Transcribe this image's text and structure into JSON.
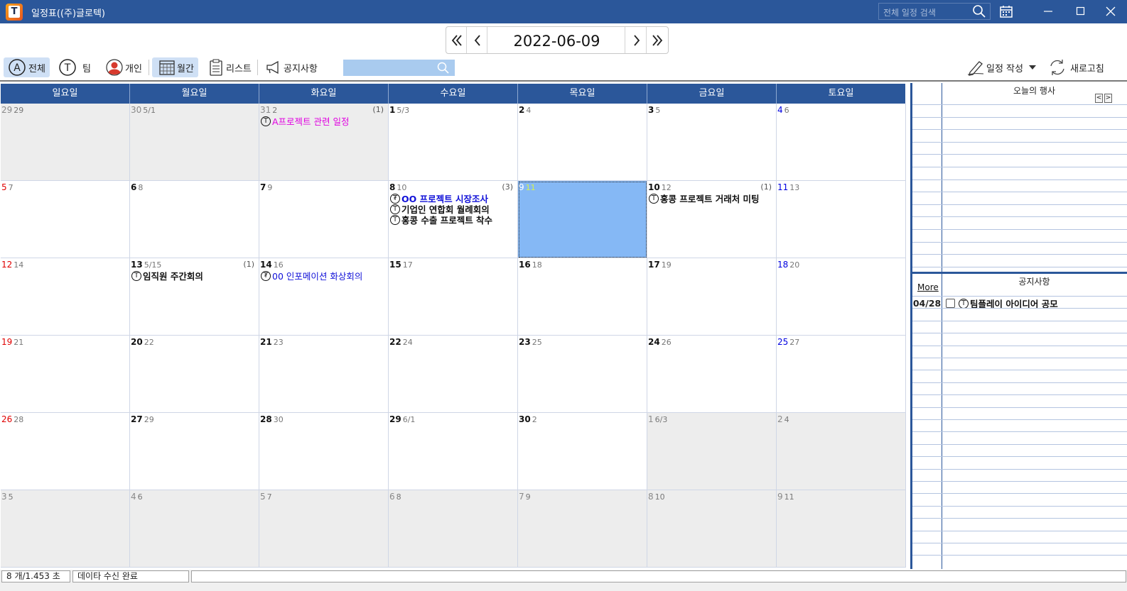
{
  "window": {
    "title": "일정표((주)글로텍)",
    "search_placeholder": "전체 일정 검색"
  },
  "app_logo_letter": "T",
  "date_nav": {
    "date": "2022-06-09"
  },
  "toolbar": {
    "all_label": "전체",
    "all_badge": "A",
    "team_label": "팀",
    "team_badge": "T",
    "personal_label": "개인",
    "monthly_label": "월간",
    "list_label": "리스트",
    "notice_label": "공지사항",
    "write_label": "일정 작성",
    "refresh_label": "새로고침"
  },
  "weekdays": [
    "일요일",
    "월요일",
    "화요일",
    "수요일",
    "목요일",
    "금요일",
    "토요일"
  ],
  "weeks": [
    [
      {
        "d": "29",
        "l": "29",
        "other": true
      },
      {
        "d": "30",
        "l": "5/1",
        "other": true
      },
      {
        "d": "31",
        "l": "2",
        "other": true,
        "count": "(1)",
        "events": [
          {
            "badge": "T",
            "text": "A프로젝트 관련 일정",
            "color": "magenta"
          }
        ]
      },
      {
        "d": "1",
        "l": "5/3"
      },
      {
        "d": "2",
        "l": "4"
      },
      {
        "d": "3",
        "l": "5"
      },
      {
        "d": "4",
        "l": "6"
      }
    ],
    [
      {
        "d": "5",
        "l": "7"
      },
      {
        "d": "6",
        "l": "8"
      },
      {
        "d": "7",
        "l": "9"
      },
      {
        "d": "8",
        "l": "10",
        "count": "(3)",
        "events": [
          {
            "badge": "₮",
            "text": "OO 프로젝트 시장조사",
            "color": "blue",
            "bold": true
          },
          {
            "badge": "T",
            "text": "기업인 연합회 월례회의",
            "color": "black"
          },
          {
            "badge": "T",
            "text": "홍콩 수출 프로젝트 착수",
            "color": "black"
          }
        ]
      },
      {
        "d": "9",
        "l": "11",
        "today": true
      },
      {
        "d": "10",
        "l": "12",
        "count": "(1)",
        "events": [
          {
            "badge": "T",
            "text": "홍콩 프로젝트 거래처 미팅",
            "color": "black"
          }
        ]
      },
      {
        "d": "11",
        "l": "13"
      }
    ],
    [
      {
        "d": "12",
        "l": "14"
      },
      {
        "d": "13",
        "l": "5/15",
        "count": "(1)",
        "events": [
          {
            "badge": "T",
            "text": "임직원 주간회의",
            "color": "black"
          }
        ]
      },
      {
        "d": "14",
        "l": "16",
        "events": [
          {
            "badge": "₮",
            "text": "00 인포메이션 화상회의",
            "color": "blue"
          }
        ]
      },
      {
        "d": "15",
        "l": "17"
      },
      {
        "d": "16",
        "l": "18"
      },
      {
        "d": "17",
        "l": "19"
      },
      {
        "d": "18",
        "l": "20"
      }
    ],
    [
      {
        "d": "19",
        "l": "21"
      },
      {
        "d": "20",
        "l": "22"
      },
      {
        "d": "21",
        "l": "23"
      },
      {
        "d": "22",
        "l": "24"
      },
      {
        "d": "23",
        "l": "25"
      },
      {
        "d": "24",
        "l": "26"
      },
      {
        "d": "25",
        "l": "27"
      }
    ],
    [
      {
        "d": "26",
        "l": "28"
      },
      {
        "d": "27",
        "l": "29"
      },
      {
        "d": "28",
        "l": "30"
      },
      {
        "d": "29",
        "l": "6/1"
      },
      {
        "d": "30",
        "l": "2"
      },
      {
        "d": "1",
        "l": "6/3",
        "other": true
      },
      {
        "d": "2",
        "l": "4",
        "other": true
      }
    ],
    [
      {
        "d": "3",
        "l": "5",
        "other": true
      },
      {
        "d": "4",
        "l": "6",
        "other": true
      },
      {
        "d": "5",
        "l": "7",
        "other": true
      },
      {
        "d": "6",
        "l": "8",
        "other": true
      },
      {
        "d": "7",
        "l": "9",
        "other": true
      },
      {
        "d": "8",
        "l": "10",
        "other": true
      },
      {
        "d": "9",
        "l": "11",
        "other": true
      }
    ]
  ],
  "right_panel": {
    "today_events_title": "오늘의 행사",
    "notice_title": "공지사항",
    "more_label": "More",
    "notices": [
      {
        "date": "04/28",
        "badge": "T",
        "text": "팀플레이 아이디어 공모"
      }
    ]
  },
  "status": {
    "count": "8 개/1.453 초",
    "message": "데이타 수신 완료"
  },
  "colors": {
    "titlebar": "#2b579a",
    "today": "#85b8f5",
    "sunday": "#e00000",
    "saturday": "#0000e0"
  }
}
